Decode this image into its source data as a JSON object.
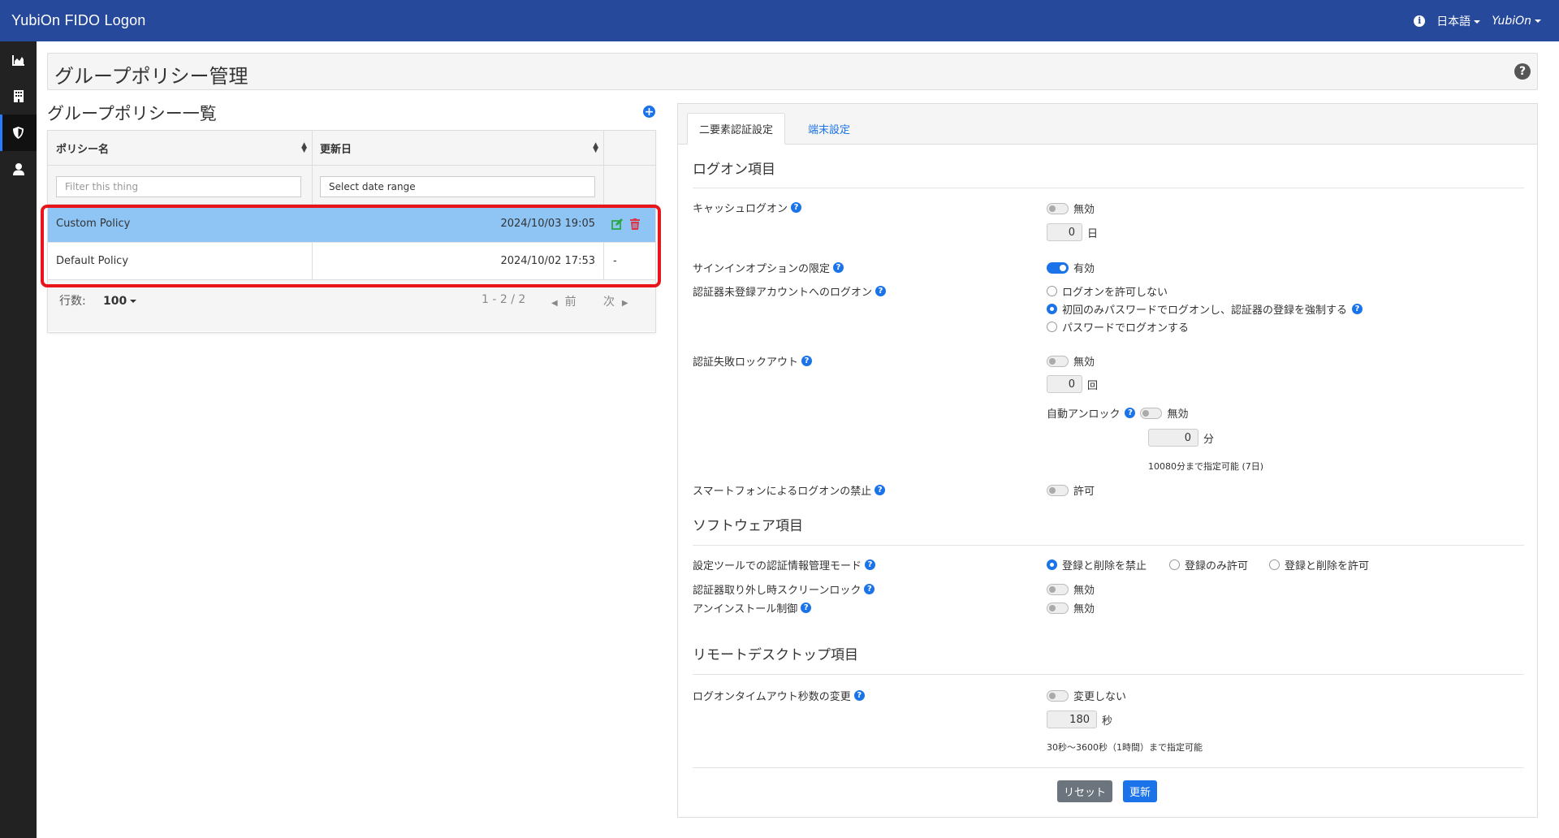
{
  "app": {
    "title": "YubiOn FIDO Logon",
    "language": "日本語",
    "user": "YubiOn"
  },
  "sidebar": {
    "items": [
      {
        "icon": "chart-icon"
      },
      {
        "icon": "building-icon"
      },
      {
        "icon": "shield-icon"
      },
      {
        "icon": "user-icon"
      }
    ]
  },
  "page": {
    "title": "グループポリシー管理",
    "help": "?"
  },
  "policy_list": {
    "title": "グループポリシー一覧",
    "add": "+",
    "columns": [
      "ポリシー名",
      "更新日"
    ],
    "filter_placeholder": "Filter this thing",
    "date_placeholder": "Select date range",
    "rows": [
      {
        "name": "Custom Policy",
        "date": "2024/10/03 19:05",
        "actions": ""
      },
      {
        "name": "Default Policy",
        "date": "2024/10/02 17:53",
        "actions": "-"
      }
    ],
    "pager": {
      "rows_label": "行数:",
      "rows_value": "100",
      "range": "1 - 2 / 2",
      "prev": "前",
      "next": "次"
    }
  },
  "settings": {
    "tabs": [
      "二要素認証設定",
      "端末設定"
    ],
    "sections": {
      "logon": "ログオン項目",
      "software": "ソフトウェア項目",
      "remote": "リモートデスクトップ項目"
    },
    "labels": {
      "cache_logon": "キャッシュログオン",
      "signin_limit": "サインインオプションの限定",
      "unregistered": "認証器未登録アカウントへのログオン",
      "lockout": "認証失敗ロックアウト",
      "auto_unlock": "自動アンロック",
      "smartphone": "スマートフォンによるログオンの禁止",
      "tool_mode": "設定ツールでの認証情報管理モード",
      "screen_lock": "認証器取り外し時スクリーンロック",
      "uninstall": "アンインストール制御",
      "timeout": "ログオンタイムアウト秒数の変更"
    },
    "values": {
      "cache_logon_state": "無効",
      "cache_days": "0",
      "unit_day": "日",
      "signin_limit_state": "有効",
      "unregistered_options": [
        "ログオンを許可しない",
        "初回のみパスワードでログオンし、認証器の登録を強制する",
        "パスワードでログオンする"
      ],
      "lockout_state": "無効",
      "lockout_count": "0",
      "unit_times": "回",
      "auto_unlock_state": "無効",
      "auto_unlock_minutes": "0",
      "unit_minutes": "分",
      "auto_unlock_note": "10080分まで指定可能 (7日)",
      "smartphone_state": "許可",
      "tool_mode_options": [
        "登録と削除を禁止",
        "登録のみ許可",
        "登録と削除を許可"
      ],
      "screen_lock_state": "無効",
      "uninstall_state": "無効",
      "timeout_state": "変更しない",
      "timeout_seconds": "180",
      "unit_seconds": "秒",
      "timeout_note": "30秒～3600秒（1時間）まで指定可能"
    },
    "buttons": {
      "reset": "リセット",
      "update": "更新"
    }
  },
  "colors": {
    "navbar": "#27499b",
    "sidebar": "#222222",
    "accent": "#1a73e8",
    "selected_row": "#8ec5f5",
    "highlight": "#e8151b"
  }
}
